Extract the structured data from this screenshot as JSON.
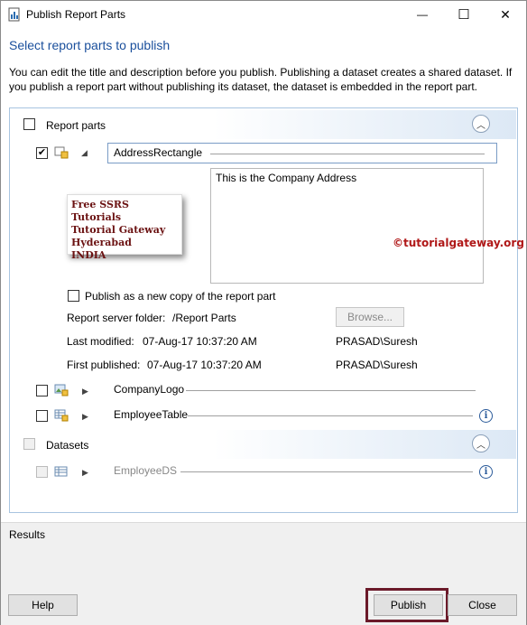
{
  "window": {
    "title": "Publish Report Parts",
    "minimize_glyph": "—",
    "maximize_glyph": "☐",
    "close_glyph": "✕"
  },
  "heading": "Select report parts to publish",
  "description": "You can edit the title and description before you publish. Publishing a dataset creates a shared dataset. If you publish a report part without publishing its dataset, the dataset is embedded in the report part.",
  "report_parts_group": {
    "label": "Report parts",
    "checked": false
  },
  "selected_part": {
    "name": "AddressRectangle",
    "checked": true,
    "description": "This is the Company Address",
    "preview_lines": [
      "Free SSRS Tutorials",
      "Tutorial Gateway",
      "Hyderabad",
      "INDIA"
    ],
    "watermark": "©tutorialgateway.org",
    "publish_copy_label": "Publish as a new copy of the report part",
    "publish_copy_checked": false,
    "server_folder_label": "Report server folder:",
    "server_folder_value": "/Report Parts",
    "browse_label": "Browse...",
    "last_modified_label": "Last modified:",
    "last_modified_value": "07-Aug-17 10:37:20 AM",
    "last_modified_user": "PRASAD\\Suresh",
    "first_published_label": "First published:",
    "first_published_value": "07-Aug-17 10:37:20 AM",
    "first_published_user": "PRASAD\\Suresh"
  },
  "other_parts": [
    {
      "name": "CompanyLogo",
      "checked": false,
      "icon": "image-part-icon"
    },
    {
      "name": "EmployeeTable",
      "checked": false,
      "icon": "table-part-icon"
    }
  ],
  "datasets_group": {
    "label": "Datasets",
    "items": [
      {
        "name": "EmployeeDS",
        "checked": false
      }
    ]
  },
  "results_label": "Results",
  "buttons": {
    "help": "Help",
    "publish": "Publish",
    "close": "Close"
  },
  "colors": {
    "heading": "#1a4f9c",
    "panel_border": "#a8c4e0",
    "watermark": "#b01818",
    "publish_highlight": "#6b1a2a"
  }
}
